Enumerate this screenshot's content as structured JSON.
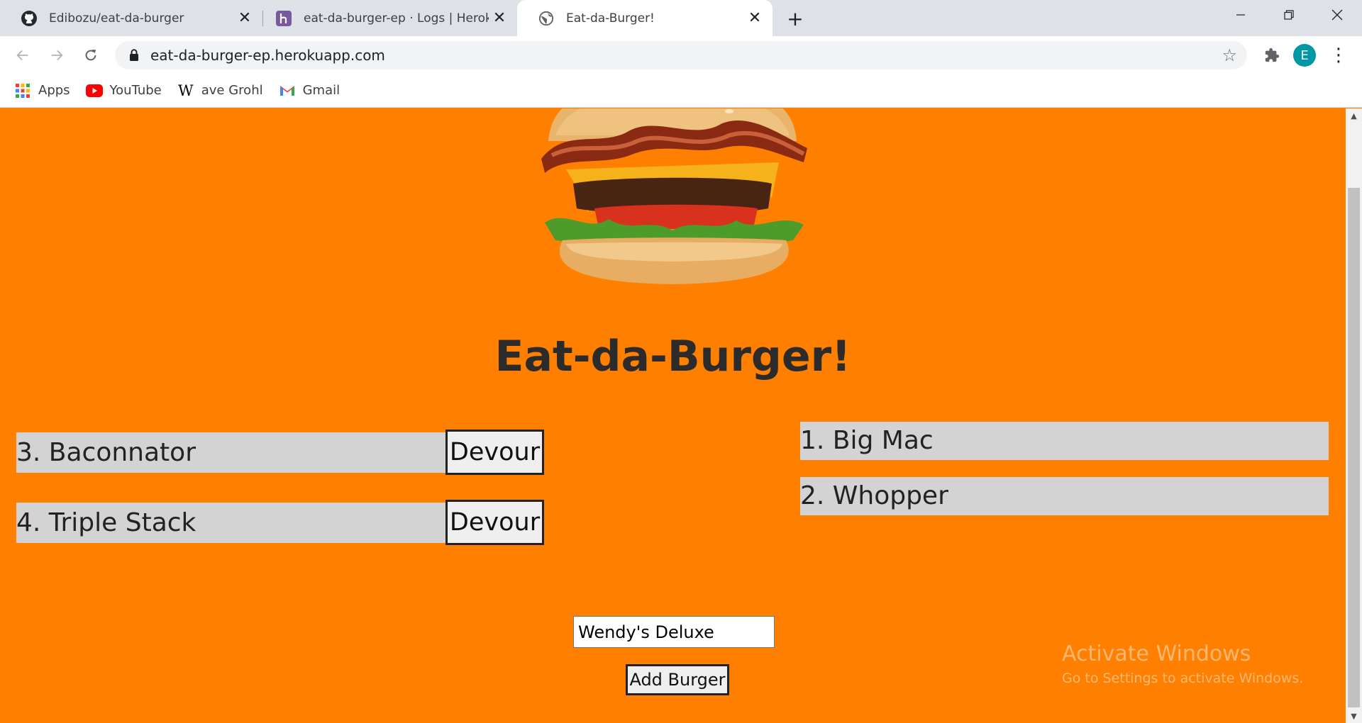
{
  "browser": {
    "tabs": [
      {
        "title": "Edibozu/eat-da-burger",
        "icon": "github-icon",
        "active": false
      },
      {
        "title": "eat-da-burger-ep · Logs | Heroku",
        "icon": "heroku-icon",
        "active": false
      },
      {
        "title": "Eat-da-Burger!",
        "icon": "globe-icon",
        "active": true
      }
    ],
    "url": "eat-da-burger-ep.herokuapp.com",
    "profile_initial": "E",
    "profile_color": "#0097a7",
    "bookmarks": [
      {
        "label": "Apps",
        "icon": "apps-grid-icon"
      },
      {
        "label": "YouTube",
        "icon": "youtube-icon"
      },
      {
        "label": "ave Grohl",
        "icon": "wikipedia-icon"
      },
      {
        "label": "Gmail",
        "icon": "gmail-icon"
      }
    ]
  },
  "page": {
    "background": "#ff7f00",
    "title": "Eat-da-Burger!",
    "hero_image": "burger-image",
    "uneaten_burgers": [
      {
        "name": "3. Baconnator",
        "action": "Devour"
      },
      {
        "name": "4. Triple Stack",
        "action": "Devour"
      }
    ],
    "devoured_burgers": [
      {
        "name": "1. Big Mac"
      },
      {
        "name": "2. Whopper"
      }
    ],
    "form": {
      "input_value": "Wendy's Deluxe",
      "submit_label": "Add Burger"
    }
  },
  "os": {
    "watermark_title": "Activate Windows",
    "watermark_subtitle": "Go to Settings to activate Windows."
  }
}
